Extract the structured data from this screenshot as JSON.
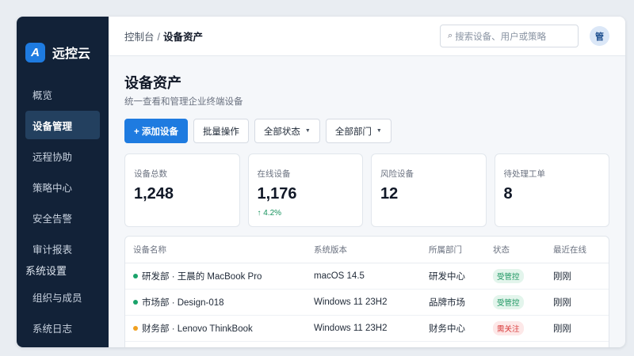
{
  "brand": {
    "logo_letter": "A",
    "name": "远控云",
    "accent": "#1e7be0"
  },
  "sidebar": {
    "items": [
      {
        "label": "概览"
      },
      {
        "label": "设备管理",
        "active": true
      },
      {
        "label": "远程协助"
      },
      {
        "label": "策略中心"
      },
      {
        "label": "安全告警"
      },
      {
        "label": "审计报表"
      }
    ],
    "group_label": "系统设置",
    "group_items": [
      {
        "label": "组织与成员"
      },
      {
        "label": "系统日志"
      }
    ]
  },
  "header": {
    "breadcrumb_root": "控制台",
    "breadcrumb_sep": "/",
    "breadcrumb_current": "设备资产",
    "search_placeholder": "搜索设备、用户或策略",
    "avatar_text": "管"
  },
  "page": {
    "title": "设备资产",
    "subtitle": "统一查看和管理企业终端设备"
  },
  "actions": {
    "add_label": "+ 添加设备",
    "batch_label": "批量操作",
    "status_filter": "全部状态",
    "dept_filter": "全部部门"
  },
  "stats": [
    {
      "label": "设备总数",
      "value": "1,248"
    },
    {
      "label": "在线设备",
      "value": "1,176",
      "trend": "↑ 4.2%"
    },
    {
      "label": "风险设备",
      "value": "12"
    },
    {
      "label": "待处理工单",
      "value": "8"
    }
  ],
  "table": {
    "headers": [
      "设备名称",
      "系统版本",
      "所属部门",
      "状态",
      "最近在线"
    ],
    "rows": [
      {
        "name": "研发部 · 王晨的 MacBook Pro",
        "os": "macOS 14.5",
        "dept": "研发中心",
        "status": "受管控",
        "status_color": "#15925c",
        "status_bg": "#e3f5ec",
        "dot_color": "#1aa36a",
        "last": "刚刚"
      },
      {
        "name": "市场部 · Design-018",
        "os": "Windows 11 23H2",
        "dept": "品牌市场",
        "status": "受管控",
        "status_color": "#15925c",
        "status_bg": "#e3f5ec",
        "dot_color": "#1aa36a",
        "last": "刚刚"
      },
      {
        "name": "财务部 · Lenovo ThinkBook",
        "os": "Windows 11 23H2",
        "dept": "财务中心",
        "status": "需关注",
        "status_color": "#d93b3b",
        "status_bg": "#fde8e8",
        "dot_color": "#f0a020",
        "last": "刚刚"
      }
    ]
  }
}
